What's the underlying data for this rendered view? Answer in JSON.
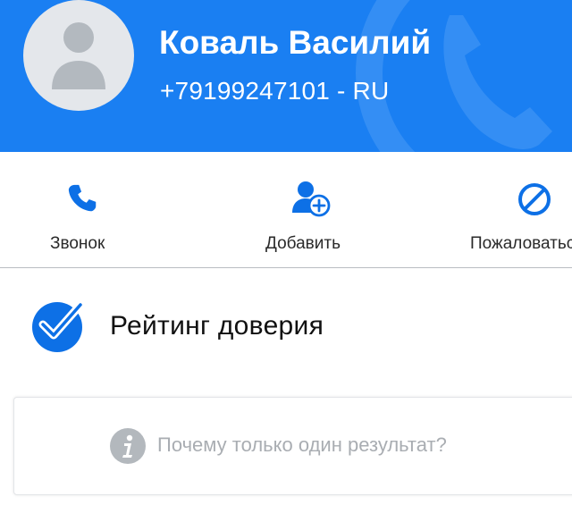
{
  "contact": {
    "name": "Коваль Василий",
    "phone": "+79199247101 - RU"
  },
  "actions": [
    {
      "label": "Звонок",
      "icon": "phone-icon"
    },
    {
      "label": "Добавить",
      "icon": "add-contact-icon"
    },
    {
      "label": "Пожаловаться",
      "icon": "block-icon"
    }
  ],
  "trust": {
    "title": "Рейтинг доверия",
    "icon": "check-badge-icon"
  },
  "info": {
    "text": "Почему только один результат?",
    "icon": "info-icon"
  },
  "colors": {
    "brand_blue": "#1a7ff2",
    "icon_blue": "#0d70e6",
    "muted_gray": "#a9adb2"
  }
}
